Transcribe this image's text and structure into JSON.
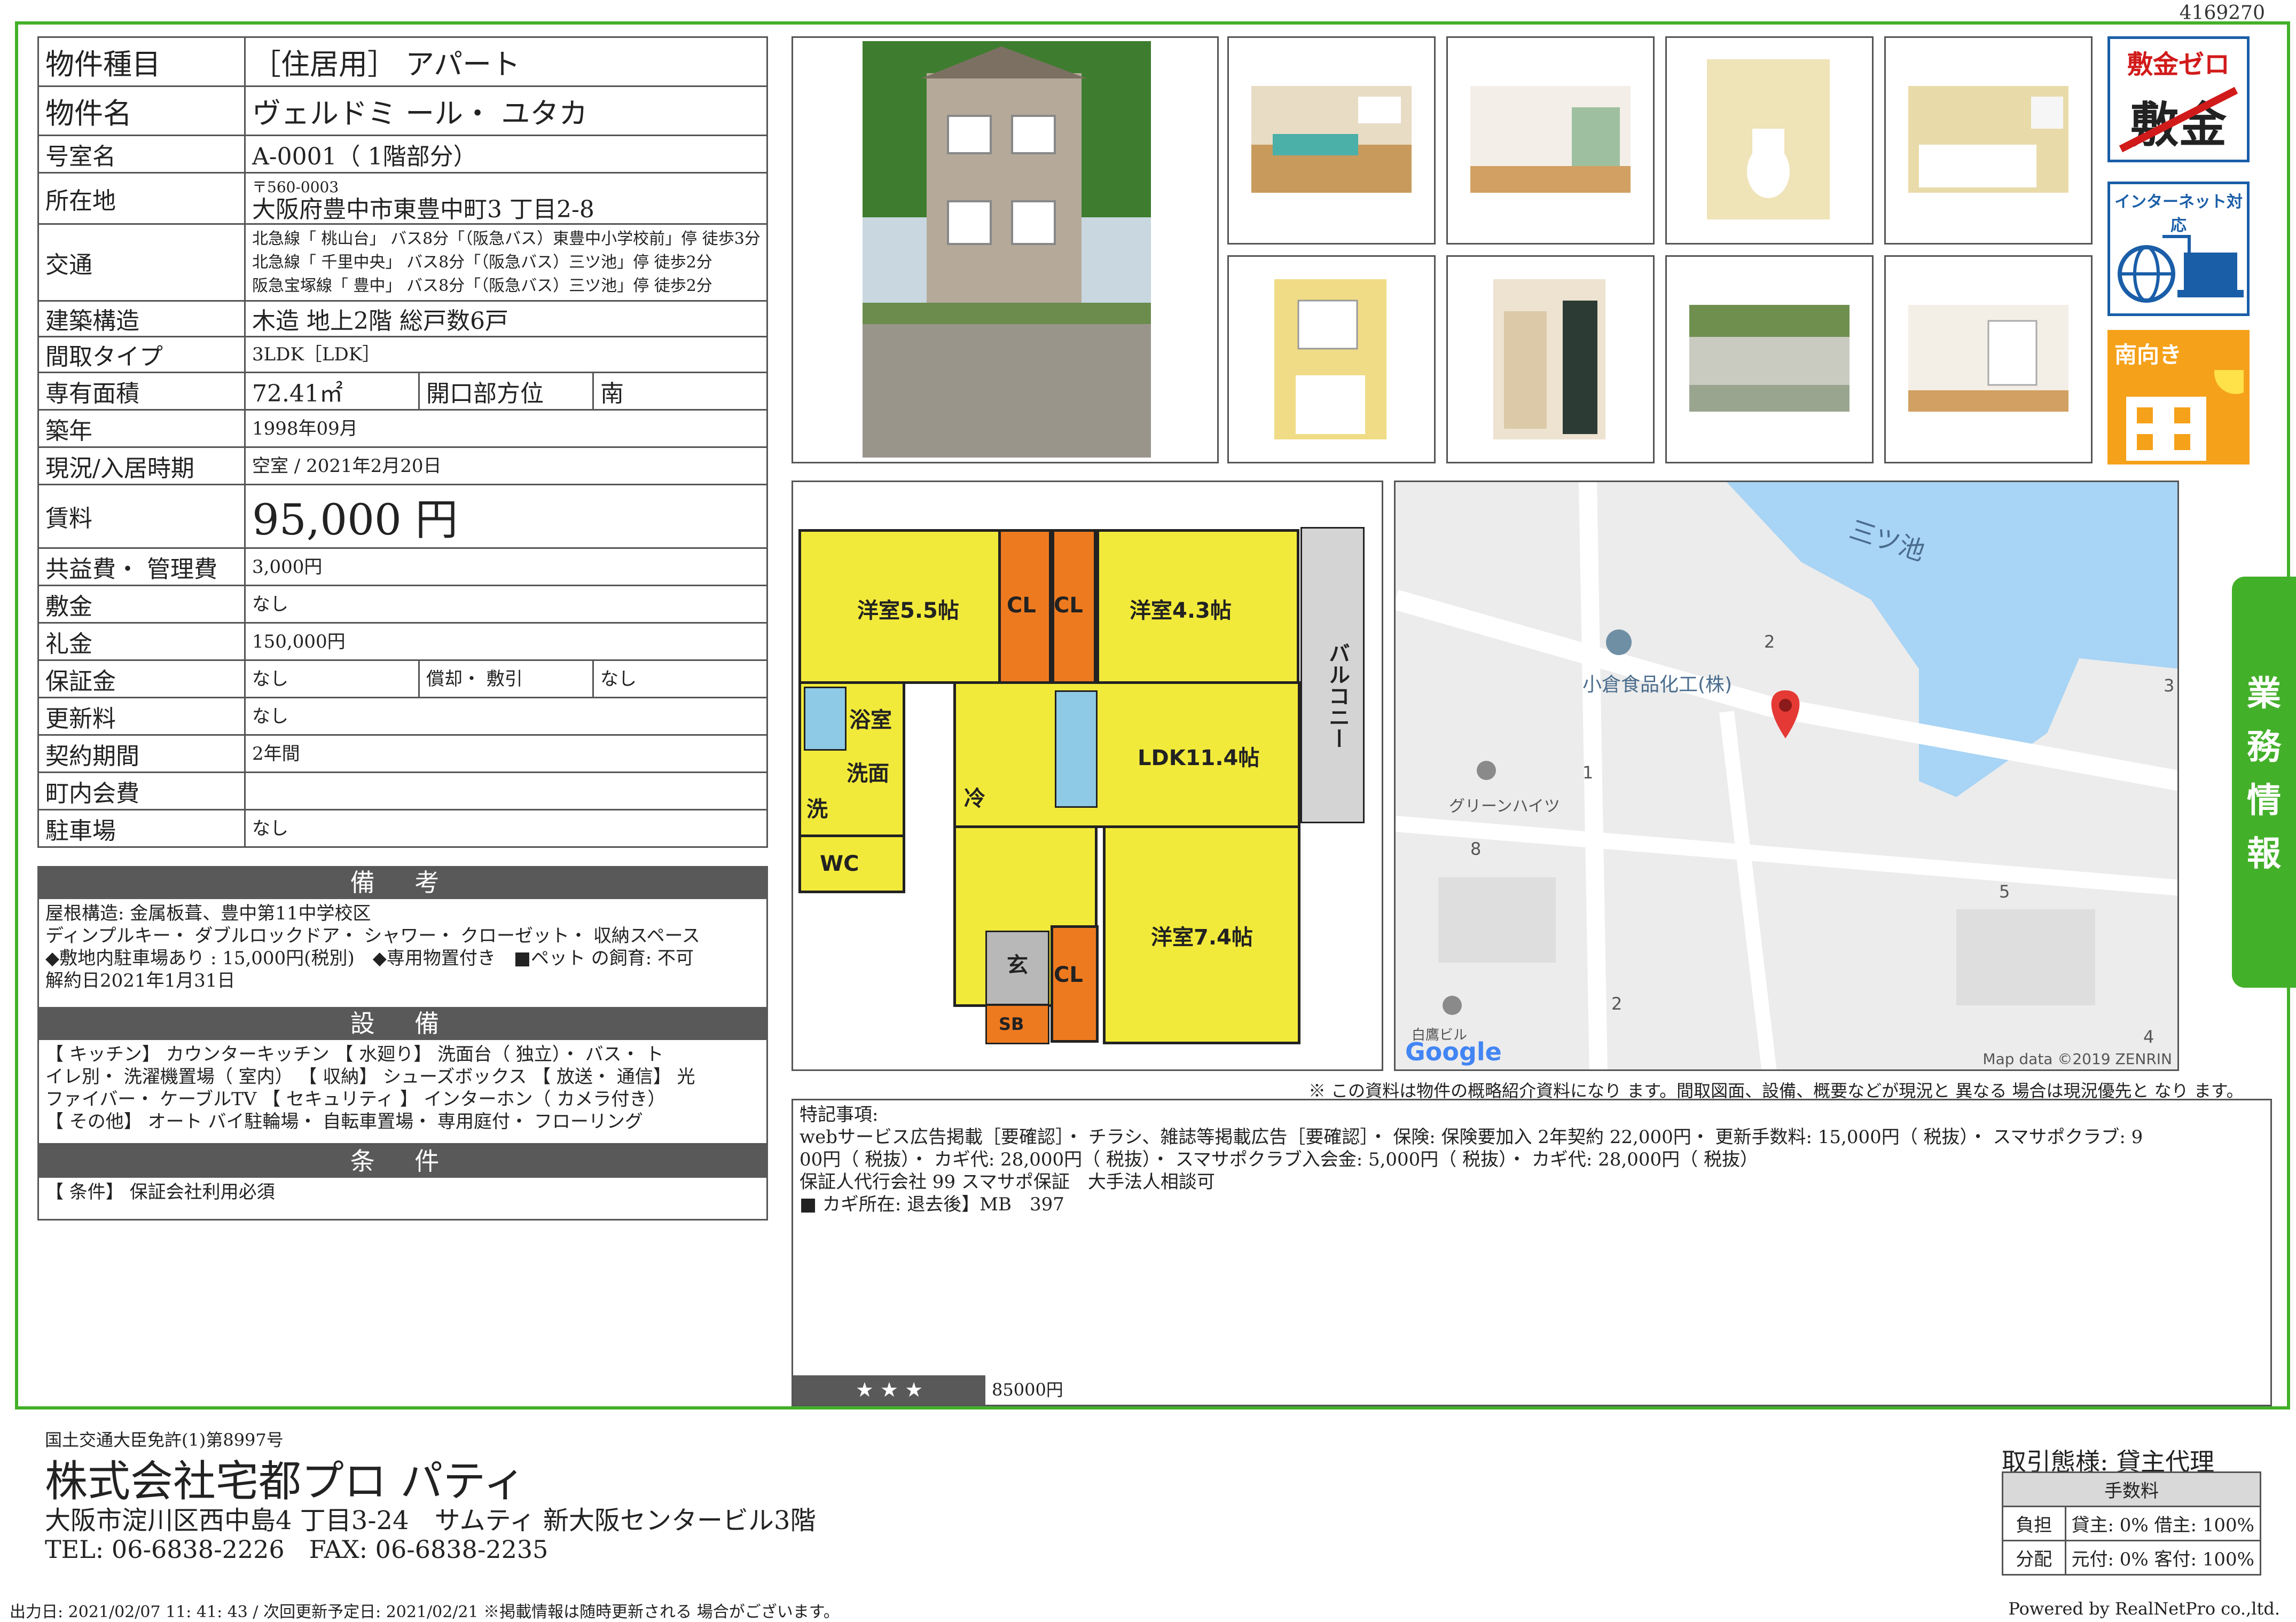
{
  "doc_id": "4169270",
  "property": {
    "type_label": "物件種目",
    "type_value": "［住居用］ アパート",
    "name_label": "物件名",
    "name_value": "ヴェルドミ ール・ ユタカ",
    "room_label": "号室名",
    "room_value": "A-0001（ 1階部分）",
    "address_label": "所在地",
    "postal": "〒560-0003",
    "address": "大阪府豊中市東豊中町3 丁目2-8",
    "transport_label": "交通",
    "transport": [
      "北急線「 桃山台」 バス8分「（阪急バス）東豊中小学校前」停 徒歩3分",
      "北急線「 千里中央」 バス8分「（阪急バス）三ツ池」停 徒歩2分",
      "阪急宝塚線「 豊中」 バス8分「（阪急バス）三ツ池」停 徒歩2分"
    ],
    "structure_label": "建築構造",
    "structure_value": "木造 地上2階 総戸数6戸",
    "layout_label": "間取タイプ",
    "layout_value": "3LDK［LDK］",
    "area_label": "専有面積",
    "area_value": "72.41㎡",
    "direction_label": "開口部方位",
    "direction_value": "南",
    "built_label": "築年",
    "built_value": "1998年09月",
    "status_label": "現況/入居時期",
    "status_value": "空室 / 2021年2月20日",
    "rent_label": "賃料",
    "rent_value": "95,000 円",
    "common_label": "共益費・ 管理費",
    "common_value": "3,000円",
    "deposit_label": "敷金",
    "deposit_value": "なし",
    "key_money_label": "礼金",
    "key_money_value": "150,000円",
    "guarantee_label": "保証金",
    "guarantee_value": "なし",
    "amort_label": "償却・ 敷引",
    "amort_value": "なし",
    "renewal_label": "更新料",
    "renewal_value": "なし",
    "contract_label": "契約期間",
    "contract_value": "2年間",
    "town_fee_label": "町内会費",
    "town_fee_value": "",
    "parking_label": "駐車場",
    "parking_value": "なし"
  },
  "remarks": {
    "title": "備 考",
    "text": "屋根構造: 金属板葺、豊中第11中学校区\nディンプルキー・ ダブルロックドア・ シャワー・ クローゼット・ 収納スペース\n◆敷地内駐車場あり : 15,000円(税別)　◆専用物置付き　■ペット の飼育: 不可\n解約日2021年1月31日"
  },
  "equipment": {
    "title": "設 備",
    "text": "【 キッチン】 カウンターキッチン 【 水廻り】 洗面台（ 独立）・ バス・ ト\nイレ別・ 洗濯機置場（ 室内） 【 収納】 シューズボックス 【 放送・ 通信】 光\nファイバー・ ケーブルTV 【 セキュリティ 】 インターホン（ カメラ付き）\n【 その他】 オート バイ駐輪場・ 自転車置場・ 専用庭付・ フローリング"
  },
  "conditions": {
    "title": "条 件",
    "text": "【 条件】 保証会社利用必須"
  },
  "badges": {
    "b1": "敷金ゼロ",
    "b1_crossed": "敷金",
    "b2": "インターネット対応",
    "b3": "南向き"
  },
  "side_tab": [
    "業",
    "務",
    "情",
    "報"
  ],
  "floorplan": {
    "rooms": [
      "洋室5.5帖",
      "洋室4.3帖",
      "LDK11.4帖",
      "洋室7.4帖"
    ],
    "balcony": "バルコニー",
    "bath": "浴室",
    "washroom": "洗面",
    "laundry": "洗",
    "wc": "WC",
    "fridge": "冷",
    "entrance": "玄",
    "sb": "SB",
    "cl": "CL"
  },
  "map": {
    "pond": "三ツ池",
    "poi1": "小倉食品化工(株)",
    "poi2": "グリーンハイツ",
    "poi3": "白鷹ビル",
    "numbers": [
      "2",
      "1",
      "3",
      "8",
      "5",
      "2",
      "4"
    ],
    "google": "Google",
    "credit": "Map data ©2019 ZENRIN"
  },
  "notice": "※ この資料は物件の概略紹介資料になり ます。間取図面、設備、概要などが現況と 異なる 場合は現況優先と なり ます。",
  "special": {
    "title": "特記事項:",
    "lines": [
      "webサービス広告掲載［要確認］・ チラシ、雑誌等掲載広告［要確認］・ 保険: 保険要加入 2年契約 22,000円・ 更新手数料: 15,000円（ 税抜）・ スマサポクラブ: 9",
      "00円（ 税抜）・ カギ代: 28,000円（ 税抜）・ スマサポクラブ入会金: 5,000円（ 税抜）・ カギ代: 28,000円（ 税抜）",
      "保証人代行会社 99 スマサポ保証　大手法人相談可",
      "■ カギ所在: 退去後】MB　397"
    ],
    "stars": "★ ★ ★",
    "stars_value": "85000円"
  },
  "company": {
    "license": "国土交通大臣免許(1)第8997号",
    "name": "株式会社宅都プロ パティ",
    "address": "大阪市淀川区西中島4 丁目3-24　サムティ 新大阪センタービル3階",
    "tel": "TEL: 06-6838-2226　FAX: 06-6838-2235"
  },
  "deal": {
    "title": "取引態様: 貸主代理",
    "fee_header": "手数料",
    "burden_label": "負担",
    "burden_value": "貸主: 0% 借主: 100%",
    "split_label": "分配",
    "split_value": "元付: 0% 客付: 100%"
  },
  "footer": {
    "left": "出力日: 2021/02/07 11: 41: 43 / 次回更新予定日: 2021/02/21 ※掲載情報は随時更新される 場合がございます。",
    "right": "Powered by RealNetPro co.,ltd."
  }
}
